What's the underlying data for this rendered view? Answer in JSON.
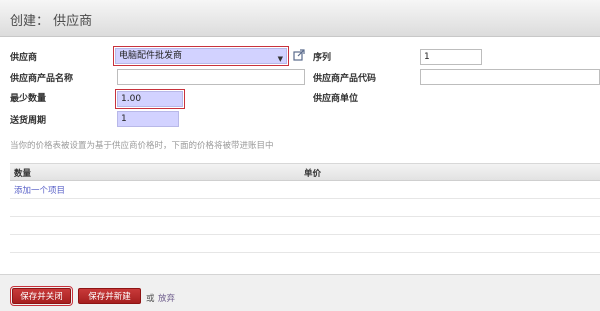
{
  "header": {
    "title": "创建： 供应商"
  },
  "form": {
    "vendor_label": "供应商",
    "vendor_value": "电脑配件批发商",
    "sequence_label": "序列",
    "sequence_value": "1",
    "vendor_product_name_label": "供应商产品名称",
    "vendor_product_name_value": "",
    "vendor_product_code_label": "供应商产品代码",
    "vendor_product_code_value": "",
    "min_qty_label": "最少数量",
    "min_qty_value": "1.00",
    "vendor_uom_label": "供应商单位",
    "lead_time_label": "送货周期",
    "lead_time_value": "1"
  },
  "help_text": "当你的价格表被设置为基于供应商价格时，下面的价格将被带进账目中",
  "price_table": {
    "columns": [
      "数量",
      "单价"
    ],
    "add_item_label": "添加一个项目"
  },
  "footer": {
    "save_close_label": "保存并关闭",
    "save_new_label": "保存并新建",
    "or_label": "或",
    "discard_label": "放弃"
  },
  "colors": {
    "accent": "#b22222",
    "required_bg": "#d2d2ff",
    "highlight": "#c8323c"
  }
}
